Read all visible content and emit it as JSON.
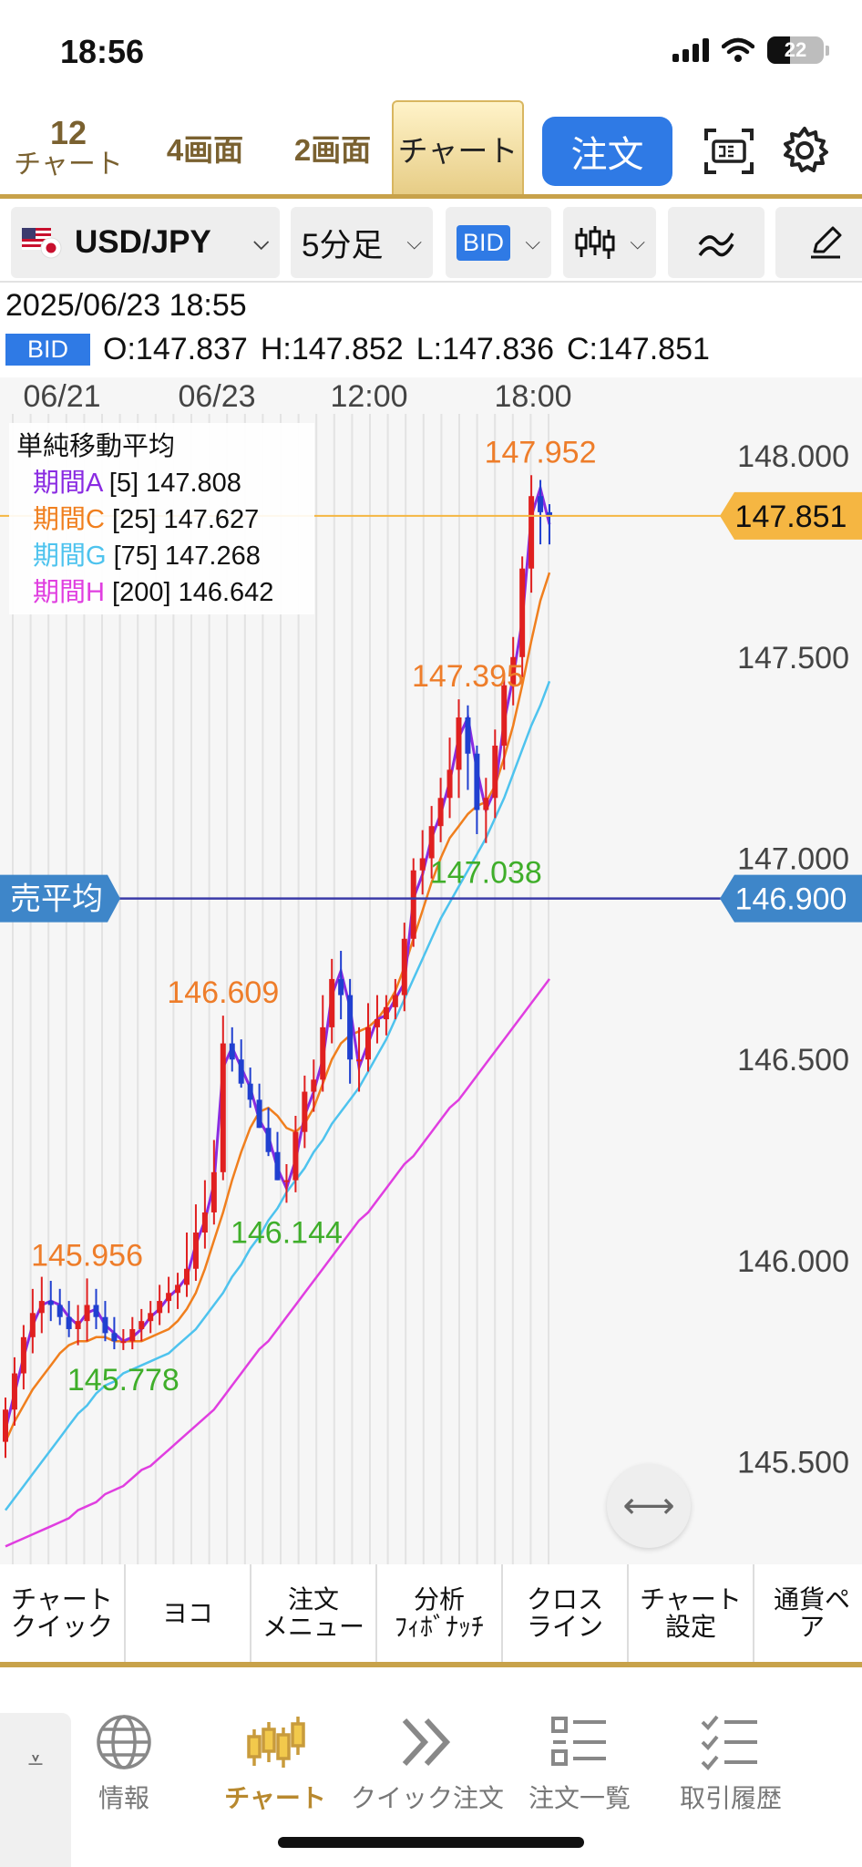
{
  "status": {
    "time": "18:56",
    "battery": "22"
  },
  "topnav": {
    "chart12_count": "12",
    "chart12_label": "チャート",
    "tab_4": "4画面",
    "tab_2": "2画面",
    "tab_chart": "チャート",
    "order_button": "注文"
  },
  "toolbar": {
    "pair": "USD/JPY",
    "timeframe": "5分足",
    "price_side": "BID"
  },
  "info": {
    "datetime": "2025/06/23 18:55",
    "bid_tag": "BID",
    "open": "O:147.837",
    "high": "H:147.852",
    "low": "L:147.836",
    "close": "C:147.851"
  },
  "legend": {
    "title": "単純移動平均",
    "rows": [
      {
        "name": "期間A",
        "period": "[5]",
        "value": "147.808",
        "color": "#8a2be2"
      },
      {
        "name": "期間C",
        "period": "[25]",
        "value": "147.627",
        "color": "#f07f1e"
      },
      {
        "name": "期間G",
        "period": "[75]",
        "value": "147.268",
        "color": "#4ec3ee"
      },
      {
        "name": "期間H",
        "period": "[200]",
        "value": "146.642",
        "color": "#e03ee0"
      }
    ]
  },
  "chart_data": {
    "type": "candlestick",
    "x_ticks": [
      "06/21",
      "06/23",
      "12:00",
      "18:00"
    ],
    "y_ticks": [
      "148.000",
      "147.500",
      "147.000",
      "146.500",
      "146.000",
      "145.500"
    ],
    "ylim": [
      145.25,
      148.05
    ],
    "current_price": {
      "value": 147.851,
      "label": "147.851",
      "color": "#f5b642"
    },
    "avg_sell": {
      "value": 146.9,
      "label": "146.900",
      "tag": "売平均",
      "color": "#3a3aa8"
    },
    "annotations": [
      {
        "label": "147.952",
        "i": 59,
        "value": 147.952,
        "kind": "high"
      },
      {
        "label": "147.395",
        "i": 51,
        "value": 147.395,
        "kind": "high"
      },
      {
        "label": "147.038",
        "i": 53,
        "value": 147.038,
        "kind": "low"
      },
      {
        "label": "146.609",
        "i": 24,
        "value": 146.609,
        "kind": "high"
      },
      {
        "label": "146.144",
        "i": 31,
        "value": 146.144,
        "kind": "low"
      },
      {
        "label": "145.956",
        "i": 9,
        "value": 145.956,
        "kind": "high"
      },
      {
        "label": "145.778",
        "i": 13,
        "value": 145.778,
        "kind": "low"
      }
    ],
    "series": [
      {
        "name": "期間C",
        "color": "#f07f1e",
        "values": [
          145.55,
          145.6,
          145.64,
          145.68,
          145.71,
          145.74,
          145.77,
          145.79,
          145.8,
          145.8,
          145.81,
          145.81,
          145.8,
          145.8,
          145.8,
          145.8,
          145.81,
          145.82,
          145.83,
          145.85,
          145.88,
          145.92,
          145.98,
          146.05,
          146.12,
          146.2,
          146.27,
          146.33,
          146.37,
          146.38,
          146.36,
          146.33,
          146.32,
          146.34,
          146.38,
          146.44,
          146.5,
          146.54,
          146.56,
          146.57,
          146.58,
          146.6,
          146.63,
          146.67,
          146.73,
          146.8,
          146.87,
          146.94,
          147.0,
          147.05,
          147.08,
          147.11,
          147.13,
          147.14,
          147.18,
          147.25,
          147.33,
          147.43,
          147.54,
          147.64,
          147.71
        ]
      },
      {
        "name": "期間G",
        "color": "#4ec3ee",
        "values": [
          145.38,
          145.41,
          145.44,
          145.47,
          145.5,
          145.53,
          145.56,
          145.59,
          145.62,
          145.64,
          145.67,
          145.69,
          145.7,
          145.72,
          145.73,
          145.74,
          145.75,
          145.76,
          145.77,
          145.79,
          145.81,
          145.83,
          145.86,
          145.89,
          145.92,
          145.96,
          145.99,
          146.03,
          146.06,
          146.1,
          146.13,
          146.17,
          146.2,
          146.23,
          146.27,
          146.3,
          146.34,
          146.37,
          146.4,
          146.43,
          146.47,
          146.51,
          146.55,
          146.6,
          146.65,
          146.7,
          146.75,
          146.8,
          146.85,
          146.89,
          146.93,
          146.97,
          147.01,
          147.05,
          147.1,
          147.15,
          147.21,
          147.27,
          147.33,
          147.38,
          147.44
        ]
      },
      {
        "name": "期間H",
        "color": "#e03ee0",
        "values": [
          145.29,
          145.3,
          145.31,
          145.32,
          145.33,
          145.34,
          145.35,
          145.36,
          145.38,
          145.39,
          145.4,
          145.42,
          145.43,
          145.44,
          145.46,
          145.48,
          145.49,
          145.51,
          145.53,
          145.55,
          145.57,
          145.59,
          145.61,
          145.63,
          145.66,
          145.69,
          145.72,
          145.75,
          145.78,
          145.8,
          145.83,
          145.86,
          145.89,
          145.92,
          145.95,
          145.98,
          146.01,
          146.04,
          146.07,
          146.1,
          146.12,
          146.15,
          146.18,
          146.21,
          146.24,
          146.26,
          146.29,
          146.32,
          146.35,
          146.38,
          146.4,
          146.43,
          146.46,
          146.49,
          146.52,
          146.55,
          146.58,
          146.61,
          146.64,
          146.67,
          146.7
        ]
      },
      {
        "name": "期間A",
        "color": "#8a2be2",
        "values": [
          145.58,
          145.67,
          145.76,
          145.84,
          145.89,
          145.9,
          145.89,
          145.86,
          145.84,
          145.87,
          145.88,
          145.84,
          145.82,
          145.8,
          145.81,
          145.83,
          145.86,
          145.88,
          145.91,
          145.93,
          145.96,
          146.04,
          146.1,
          146.19,
          146.48,
          146.53,
          146.48,
          146.43,
          146.35,
          146.31,
          146.23,
          146.18,
          146.25,
          146.36,
          146.42,
          146.5,
          146.66,
          146.72,
          146.63,
          146.48,
          146.54,
          146.6,
          146.61,
          146.65,
          146.69,
          146.9,
          146.96,
          147.05,
          147.11,
          147.19,
          147.3,
          147.35,
          147.22,
          147.12,
          147.17,
          147.34,
          147.45,
          147.59,
          147.85,
          147.92,
          147.83
        ]
      }
    ],
    "candles": {
      "open": [
        145.55,
        145.63,
        145.72,
        145.81,
        145.87,
        145.9,
        145.89,
        145.86,
        145.83,
        145.85,
        145.89,
        145.86,
        145.82,
        145.8,
        145.8,
        145.83,
        145.85,
        145.87,
        145.9,
        145.92,
        145.94,
        145.98,
        146.07,
        146.12,
        146.22,
        146.54,
        146.5,
        146.44,
        146.4,
        146.33,
        146.27,
        146.2,
        146.2,
        146.32,
        146.42,
        146.45,
        146.58,
        146.7,
        146.66,
        146.5,
        146.5,
        146.58,
        146.6,
        146.63,
        146.66,
        146.8,
        146.97,
        147.0,
        147.08,
        147.15,
        147.22,
        147.35,
        147.26,
        147.12,
        147.15,
        147.28,
        147.43,
        147.5,
        147.72,
        147.9,
        147.86
      ],
      "high": [
        145.66,
        145.76,
        145.84,
        145.93,
        145.96,
        145.95,
        145.93,
        145.9,
        145.89,
        145.956,
        145.93,
        145.9,
        145.86,
        145.83,
        145.86,
        145.88,
        145.9,
        145.94,
        145.96,
        145.97,
        146.07,
        146.14,
        146.2,
        146.3,
        146.609,
        146.58,
        146.55,
        146.48,
        146.44,
        146.38,
        146.32,
        146.24,
        146.36,
        146.46,
        146.5,
        146.66,
        146.75,
        146.77,
        146.7,
        146.58,
        146.64,
        146.66,
        146.66,
        146.7,
        146.84,
        147.0,
        147.07,
        147.13,
        147.2,
        147.3,
        147.395,
        147.38,
        147.28,
        147.2,
        147.32,
        147.46,
        147.55,
        147.75,
        147.952,
        147.94,
        147.88
      ],
      "low": [
        145.51,
        145.59,
        145.68,
        145.77,
        145.82,
        145.85,
        145.84,
        145.81,
        145.79,
        145.8,
        145.83,
        145.8,
        145.78,
        145.778,
        145.78,
        145.8,
        145.82,
        145.84,
        145.87,
        145.88,
        145.91,
        145.95,
        146.03,
        146.09,
        146.2,
        146.47,
        146.43,
        146.38,
        146.33,
        146.26,
        146.2,
        146.144,
        146.17,
        146.28,
        146.37,
        146.42,
        146.54,
        146.6,
        146.44,
        146.42,
        146.47,
        146.54,
        146.56,
        146.6,
        146.62,
        146.78,
        146.91,
        146.95,
        147.04,
        147.1,
        147.15,
        147.17,
        147.06,
        147.038,
        147.1,
        147.22,
        147.38,
        147.45,
        147.66,
        147.78,
        147.78
      ],
      "close": [
        145.63,
        145.72,
        145.81,
        145.87,
        145.9,
        145.89,
        145.86,
        145.83,
        145.85,
        145.89,
        145.86,
        145.82,
        145.8,
        145.8,
        145.83,
        145.85,
        145.87,
        145.9,
        145.92,
        145.94,
        145.98,
        146.07,
        146.12,
        146.22,
        146.54,
        146.5,
        146.44,
        146.4,
        146.33,
        146.27,
        146.2,
        146.2,
        146.32,
        146.42,
        146.45,
        146.58,
        146.7,
        146.66,
        146.5,
        146.5,
        146.58,
        146.6,
        146.63,
        146.66,
        146.8,
        146.97,
        147.0,
        147.08,
        147.15,
        147.22,
        147.35,
        147.26,
        147.12,
        147.15,
        147.28,
        147.43,
        147.5,
        147.72,
        147.9,
        147.86,
        147.851
      ]
    }
  },
  "quick_menu": [
    "チャート\nクイック",
    "ヨコ",
    "注文\nメニュー",
    "分析\nﾌｨﾎﾞﾅｯﾁ",
    "クロス\nライン",
    "チャート\n設定",
    "通貨ペア"
  ],
  "bottom_nav": [
    "情報",
    "チャート",
    "クイック注文",
    "注文一覧",
    "取引履歴"
  ],
  "colors": {
    "accent_gold": "#c8a24a",
    "primary_blue": "#2f7ae5",
    "up_candle": "#e02020",
    "down_candle": "#2040d0"
  }
}
